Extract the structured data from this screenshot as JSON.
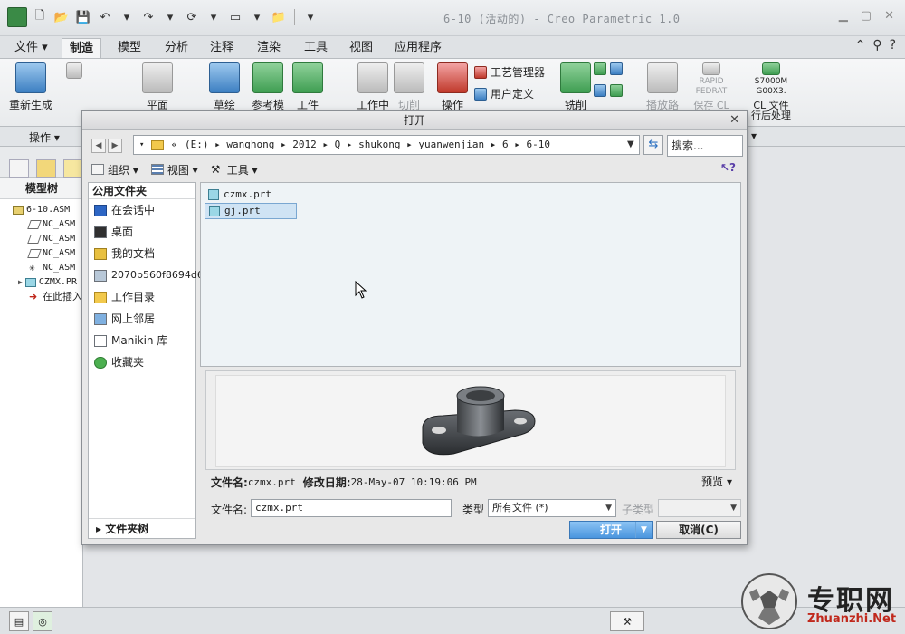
{
  "window": {
    "title": "6-10 (活动的) - Creo Parametric 1.0"
  },
  "ribbon_tabs": [
    {
      "label": "文件 ▾",
      "x": 0
    },
    {
      "label": "制造"
    },
    {
      "label": "模型"
    },
    {
      "label": "分析"
    },
    {
      "label": "注释"
    },
    {
      "label": "渲染"
    },
    {
      "label": "工具"
    },
    {
      "label": "视图"
    },
    {
      "label": "应用程序"
    }
  ],
  "ribbon": {
    "regenerate": "重新生成",
    "plane": "平面",
    "sketch": "草绘",
    "ref_model": "参考模",
    "workpiece": "工件",
    "work_center": "工作中",
    "cut": "切削",
    "operation": "操作",
    "process_manager": "工艺管理器",
    "user_defined": "用户定义",
    "mill": "铣削",
    "play_path": "播放路",
    "rapid": "RAPID",
    "fedrat": "FEDRAT",
    "save_cl": "保存 CL 文",
    "s7000": "S7000M",
    "g00": "G00X3.",
    "cl_file": "CL 文件",
    "post_process": "行后处理"
  },
  "group_bar": {
    "operation": "操作 ▾"
  },
  "model_tree": {
    "title": "模型树",
    "items": [
      {
        "label": "6-10.ASM",
        "kind": "asm"
      },
      {
        "label": "NC_ASM",
        "kind": "plane"
      },
      {
        "label": "NC_ASM",
        "kind": "plane"
      },
      {
        "label": "NC_ASM",
        "kind": "plane"
      },
      {
        "label": "NC_ASM",
        "kind": "csys"
      },
      {
        "label": "CZMX.PR",
        "kind": "prt"
      },
      {
        "label": "在此插入",
        "kind": "insert"
      }
    ]
  },
  "dialog": {
    "title": "打开",
    "path_prefix": "«",
    "path": "(E:) ▸ wanghong ▸ 2012 ▸ Q ▸ shukong ▸ yuanwenjian ▸ 6 ▸ 6-10",
    "search_placeholder": "搜索...",
    "toolbar": {
      "organize": "组织 ▾",
      "view": "视图 ▾",
      "tools": "工具 ▾"
    },
    "places_title": "公用文件夹",
    "places": [
      {
        "label": "在会话中",
        "icon": "session"
      },
      {
        "label": "桌面",
        "icon": "desktop"
      },
      {
        "label": "我的文档",
        "icon": "docs"
      },
      {
        "label": "2070b560f8694d6",
        "icon": "pc"
      },
      {
        "label": "工作目录",
        "icon": "work"
      },
      {
        "label": "网上邻居",
        "icon": "net"
      },
      {
        "label": "Manikin 库",
        "icon": "lib"
      },
      {
        "label": "收藏夹",
        "icon": "fav"
      }
    ],
    "folder_tree": "▸ 文件夹树",
    "files": [
      {
        "name": "czmx.prt",
        "selected": false
      },
      {
        "name": "gj.prt",
        "selected": true
      }
    ],
    "info": {
      "file_label": "文件名:",
      "file_value": "czmx.prt",
      "date_label": "修改日期:",
      "date_value": "28-May-07 10:19:06 PM",
      "preview_toggle": "预览 ▾"
    },
    "name_label": "文件名:",
    "name_value": "czmx.prt",
    "type_label": "类型",
    "type_value": "所有文件 (*)",
    "subtype_label": "子类型",
    "open_button": "打开",
    "cancel_button": "取消(C)"
  },
  "watermark": {
    "cn": "专职网",
    "en": "Zhuanzhi.Net"
  }
}
